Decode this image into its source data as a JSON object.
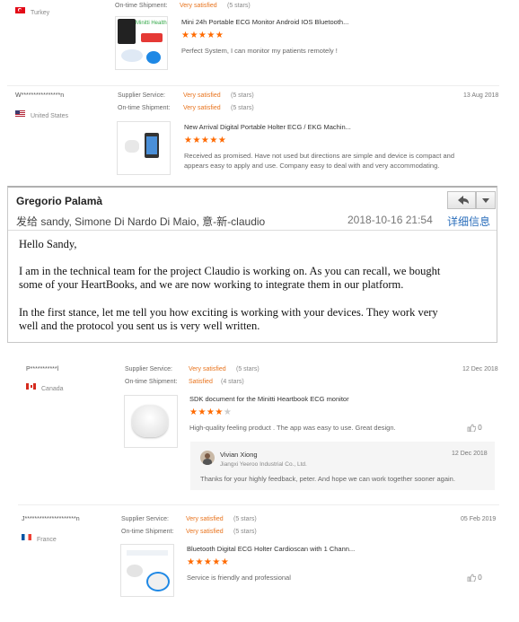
{
  "review1": {
    "country": "Turkey",
    "shipment_label": "On-time Shipment:",
    "shipment_value": "Very satisfied",
    "shipment_stars": "(5 stars)",
    "product_title": "Mini 24h Portable ECG Monitor Android IOS Bluetooth...",
    "rating": 5,
    "text": "Perfect System, I can monitor my patients remotely !",
    "thumb_label": "Minitti Health"
  },
  "review2": {
    "user": "W****************n",
    "country": "United States",
    "supplier_label": "Supplier Service:",
    "supplier_value": "Very satisfied",
    "supplier_stars": "(5 stars)",
    "shipment_label": "On-time Shipment:",
    "shipment_value": "Very satisfied",
    "shipment_stars": "(5 stars)",
    "date": "13 Aug 2018",
    "product_title": "New Arrival Digital Portable Holter ECG / EKG Machin...",
    "rating": 5,
    "text_line1": "Received as promised. Have not used but directions are simple and device is compact and",
    "text_line2": "appears easy to apply and use. Company easy to deal with and very accommodating."
  },
  "email": {
    "sender": "Gregorio Palamà",
    "to_line": "发给 sandy, Simone Di Nardo Di Maio, 意-新-claudio",
    "datetime": "2018-10-16 21:54",
    "details_link": "详细信息",
    "greeting": "Hello Sandy,",
    "para1_line1": "I am in the technical team for the project Claudio is working on. As you can recall, we bought",
    "para1_line2": "some of your HeartBooks, and we are now working to integrate them in our platform.",
    "para2_line1": "In the first stance, let me tell you how exciting is working with your devices. They work very",
    "para2_line2": "well and the protocol you sent us is very well written."
  },
  "review3": {
    "user": "P***********l",
    "country": "Canada",
    "supplier_label": "Supplier Service:",
    "supplier_value": "Very satisfied",
    "supplier_stars": "(5 stars)",
    "shipment_label": "On-time Shipment:",
    "shipment_value": "Satisfied",
    "shipment_stars": "(4 stars)",
    "date": "12 Dec 2018",
    "product_title": "SDK document for the Minitti Heartbook ECG monitor",
    "rating": 4,
    "text": "High-quality feeling product . The app was easy to use. Great design.",
    "likes": "0",
    "reply": {
      "name": "Vivian Xiong",
      "company": "Jiangxi Yeeroo Industrial Co., Ltd.",
      "date": "12 Dec 2018",
      "text": "Thanks for your highly feedback, peter. And hope we can work together sooner again."
    }
  },
  "review4": {
    "user": "J*********************n",
    "country": "France",
    "supplier_label": "Supplier Service:",
    "supplier_value": "Very satisfied",
    "supplier_stars": "(5 stars)",
    "shipment_label": "On-time Shipment:",
    "shipment_value": "Very satisfied",
    "shipment_stars": "(5 stars)",
    "date": "05 Feb 2019",
    "product_title": "Bluetooth Digital ECG Holter Cardioscan with 1 Chann...",
    "rating": 5,
    "text": "Service is friendly and professional",
    "likes": "0"
  },
  "colors": {
    "accent": "#ff6a00",
    "satisfied": "#e8741e"
  },
  "icons": [
    "turkey-flag-icon",
    "us-flag-icon",
    "canada-flag-icon",
    "france-flag-icon",
    "reply-icon",
    "dropdown-icon",
    "thumbs-up-icon",
    "star-icon"
  ]
}
